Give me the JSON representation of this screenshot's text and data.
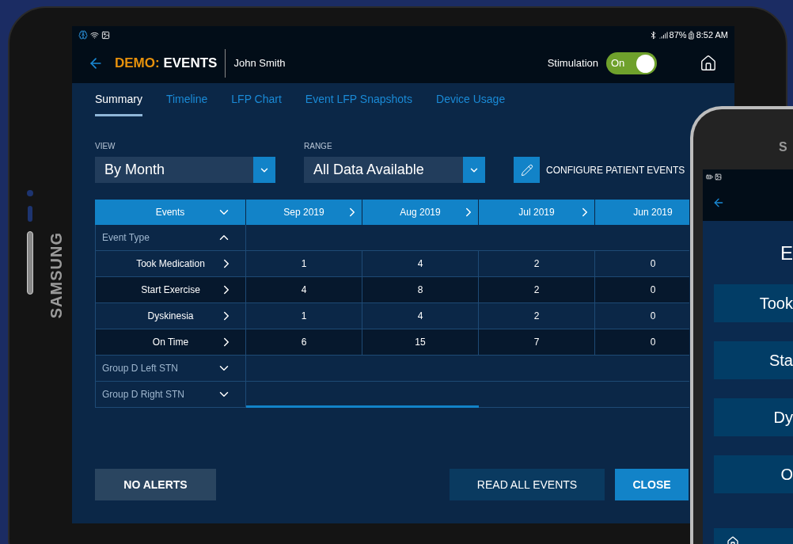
{
  "tablet": {
    "brand": "SAMSUNG"
  },
  "status_bar": {
    "battery": "87%",
    "time": "8:52 AM"
  },
  "header": {
    "title_prefix": "DEMO:",
    "title": "EVENTS",
    "patient": "John Smith",
    "stimulation": {
      "label": "Stimulation",
      "on": true,
      "state_text": "On"
    }
  },
  "tabs": [
    {
      "label": "Summary",
      "selected": true
    },
    {
      "label": "Timeline",
      "selected": false
    },
    {
      "label": "LFP Chart",
      "selected": false
    },
    {
      "label": "Event LFP Snapshots",
      "selected": false
    },
    {
      "label": "Device Usage",
      "selected": false
    }
  ],
  "view": {
    "label": "VIEW",
    "value": "By Month"
  },
  "range": {
    "label": "RANGE",
    "value": "All Data Available"
  },
  "configure_button": "CONFIGURE PATIENT EVENTS",
  "table": {
    "first_column": "Events",
    "columns": [
      "Sep 2019",
      "Aug 2019",
      "Jul 2019",
      "Jun 2019"
    ],
    "groups": [
      {
        "label": "Event Type",
        "expanded": true,
        "rows": [
          {
            "label": "Took Medication",
            "values": [
              "1",
              "4",
              "2",
              "0"
            ]
          },
          {
            "label": "Start Exercise",
            "values": [
              "4",
              "8",
              "2",
              "0"
            ]
          },
          {
            "label": "Dyskinesia",
            "values": [
              "1",
              "4",
              "2",
              "0"
            ]
          },
          {
            "label": "On Time",
            "values": [
              "6",
              "15",
              "7",
              "0"
            ]
          }
        ]
      },
      {
        "label": "Group D Left STN",
        "expanded": false
      },
      {
        "label": "Group D Right STN",
        "expanded": false
      }
    ]
  },
  "buttons": {
    "no_alerts": "NO ALERTS",
    "read_all": "READ ALL EVENTS",
    "close": "CLOSE"
  },
  "phone": {
    "brand": "S",
    "title": "E",
    "buttons": [
      "Took",
      "Sta",
      "Dy",
      "O"
    ]
  }
}
